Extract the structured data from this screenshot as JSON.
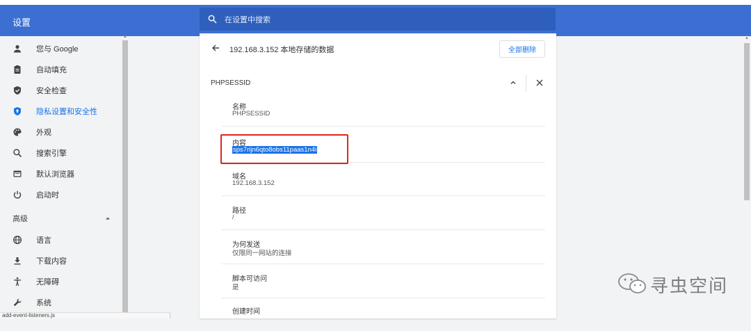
{
  "app": {
    "title": "设置"
  },
  "search": {
    "placeholder": "在设置中搜索"
  },
  "sidebar": {
    "items": [
      {
        "label": "您与 Google",
        "icon": "person-icon"
      },
      {
        "label": "自动填充",
        "icon": "clipboard-icon"
      },
      {
        "label": "安全检查",
        "icon": "shield-check-icon"
      },
      {
        "label": "隐私设置和安全性",
        "icon": "privacy-shield-icon",
        "active": true
      },
      {
        "label": "外观",
        "icon": "palette-icon"
      },
      {
        "label": "搜索引擎",
        "icon": "search-icon"
      },
      {
        "label": "默认浏览器",
        "icon": "browser-icon"
      },
      {
        "label": "启动时",
        "icon": "power-icon"
      }
    ],
    "advanced_label": "高级",
    "advanced_items": [
      {
        "label": "语言",
        "icon": "globe-icon"
      },
      {
        "label": "下载内容",
        "icon": "download-icon"
      },
      {
        "label": "无障碍",
        "icon": "accessibility-icon"
      },
      {
        "label": "系统",
        "icon": "wrench-icon"
      }
    ]
  },
  "panel": {
    "back_title": "192.168.3.152 本地存储的数据",
    "delete_all_label": "全部删除",
    "cookie_name": "PHPSESSID",
    "fields": [
      {
        "key": "名称",
        "value": "PHPSESSID"
      },
      {
        "key": "内容",
        "value": "sps7rijn6qto8obs11paas1n4i",
        "selected": true
      },
      {
        "key": "域名",
        "value": "192.168.3.152"
      },
      {
        "key": "路径",
        "value": "/"
      },
      {
        "key": "为何发送",
        "value": "仅限同一网站的连接"
      },
      {
        "key": "脚本可访问",
        "value": "是"
      },
      {
        "key": "创建时间",
        "value": ""
      }
    ]
  },
  "watermark": {
    "text": "寻虫空间"
  },
  "statusbar": {
    "text": "add-event-listeners.js"
  },
  "colors": {
    "header_blue": "#3c6fd1",
    "accent": "#1a73e8",
    "highlight_box": "#e0251b"
  }
}
